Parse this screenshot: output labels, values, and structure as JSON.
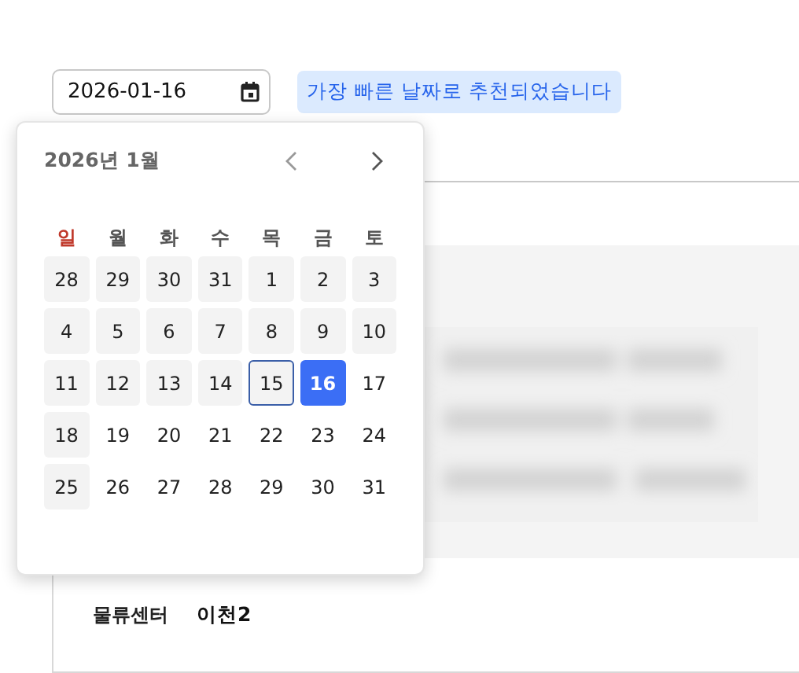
{
  "date_field": {
    "value": "2026-01-16"
  },
  "notice_badge": "가장 빠른 날짜로 추천되었습니다",
  "calendar": {
    "month_title": "2026년 1월",
    "weekdays": [
      {
        "label": "일",
        "kind": "sunday"
      },
      {
        "label": "월",
        "kind": "weekday"
      },
      {
        "label": "화",
        "kind": "weekday"
      },
      {
        "label": "수",
        "kind": "weekday"
      },
      {
        "label": "목",
        "kind": "weekday"
      },
      {
        "label": "금",
        "kind": "weekday"
      },
      {
        "label": "토",
        "kind": "weekday"
      }
    ],
    "days": [
      {
        "label": "28",
        "disabled": true,
        "today": false,
        "selected": false
      },
      {
        "label": "29",
        "disabled": true,
        "today": false,
        "selected": false
      },
      {
        "label": "30",
        "disabled": true,
        "today": false,
        "selected": false
      },
      {
        "label": "31",
        "disabled": true,
        "today": false,
        "selected": false
      },
      {
        "label": "1",
        "disabled": true,
        "today": false,
        "selected": false
      },
      {
        "label": "2",
        "disabled": true,
        "today": false,
        "selected": false
      },
      {
        "label": "3",
        "disabled": true,
        "today": false,
        "selected": false
      },
      {
        "label": "4",
        "disabled": true,
        "today": false,
        "selected": false
      },
      {
        "label": "5",
        "disabled": true,
        "today": false,
        "selected": false
      },
      {
        "label": "6",
        "disabled": true,
        "today": false,
        "selected": false
      },
      {
        "label": "7",
        "disabled": true,
        "today": false,
        "selected": false
      },
      {
        "label": "8",
        "disabled": true,
        "today": false,
        "selected": false
      },
      {
        "label": "9",
        "disabled": true,
        "today": false,
        "selected": false
      },
      {
        "label": "10",
        "disabled": true,
        "today": false,
        "selected": false
      },
      {
        "label": "11",
        "disabled": true,
        "today": false,
        "selected": false
      },
      {
        "label": "12",
        "disabled": true,
        "today": false,
        "selected": false
      },
      {
        "label": "13",
        "disabled": true,
        "today": false,
        "selected": false
      },
      {
        "label": "14",
        "disabled": true,
        "today": false,
        "selected": false
      },
      {
        "label": "15",
        "disabled": true,
        "today": true,
        "selected": false
      },
      {
        "label": "16",
        "disabled": false,
        "today": false,
        "selected": true
      },
      {
        "label": "17",
        "disabled": false,
        "today": false,
        "selected": false
      },
      {
        "label": "18",
        "disabled": true,
        "today": false,
        "selected": false
      },
      {
        "label": "19",
        "disabled": false,
        "today": false,
        "selected": false
      },
      {
        "label": "20",
        "disabled": false,
        "today": false,
        "selected": false
      },
      {
        "label": "21",
        "disabled": false,
        "today": false,
        "selected": false
      },
      {
        "label": "22",
        "disabled": false,
        "today": false,
        "selected": false
      },
      {
        "label": "23",
        "disabled": false,
        "today": false,
        "selected": false
      },
      {
        "label": "24",
        "disabled": false,
        "today": false,
        "selected": false
      },
      {
        "label": "25",
        "disabled": true,
        "today": false,
        "selected": false
      },
      {
        "label": "26",
        "disabled": false,
        "today": false,
        "selected": false
      },
      {
        "label": "27",
        "disabled": false,
        "today": false,
        "selected": false
      },
      {
        "label": "28",
        "disabled": false,
        "today": false,
        "selected": false
      },
      {
        "label": "29",
        "disabled": false,
        "today": false,
        "selected": false
      },
      {
        "label": "30",
        "disabled": false,
        "today": false,
        "selected": false
      },
      {
        "label": "31",
        "disabled": false,
        "today": false,
        "selected": false
      }
    ]
  },
  "detail_row": {
    "label": "물류센터",
    "value": "이천2"
  }
}
